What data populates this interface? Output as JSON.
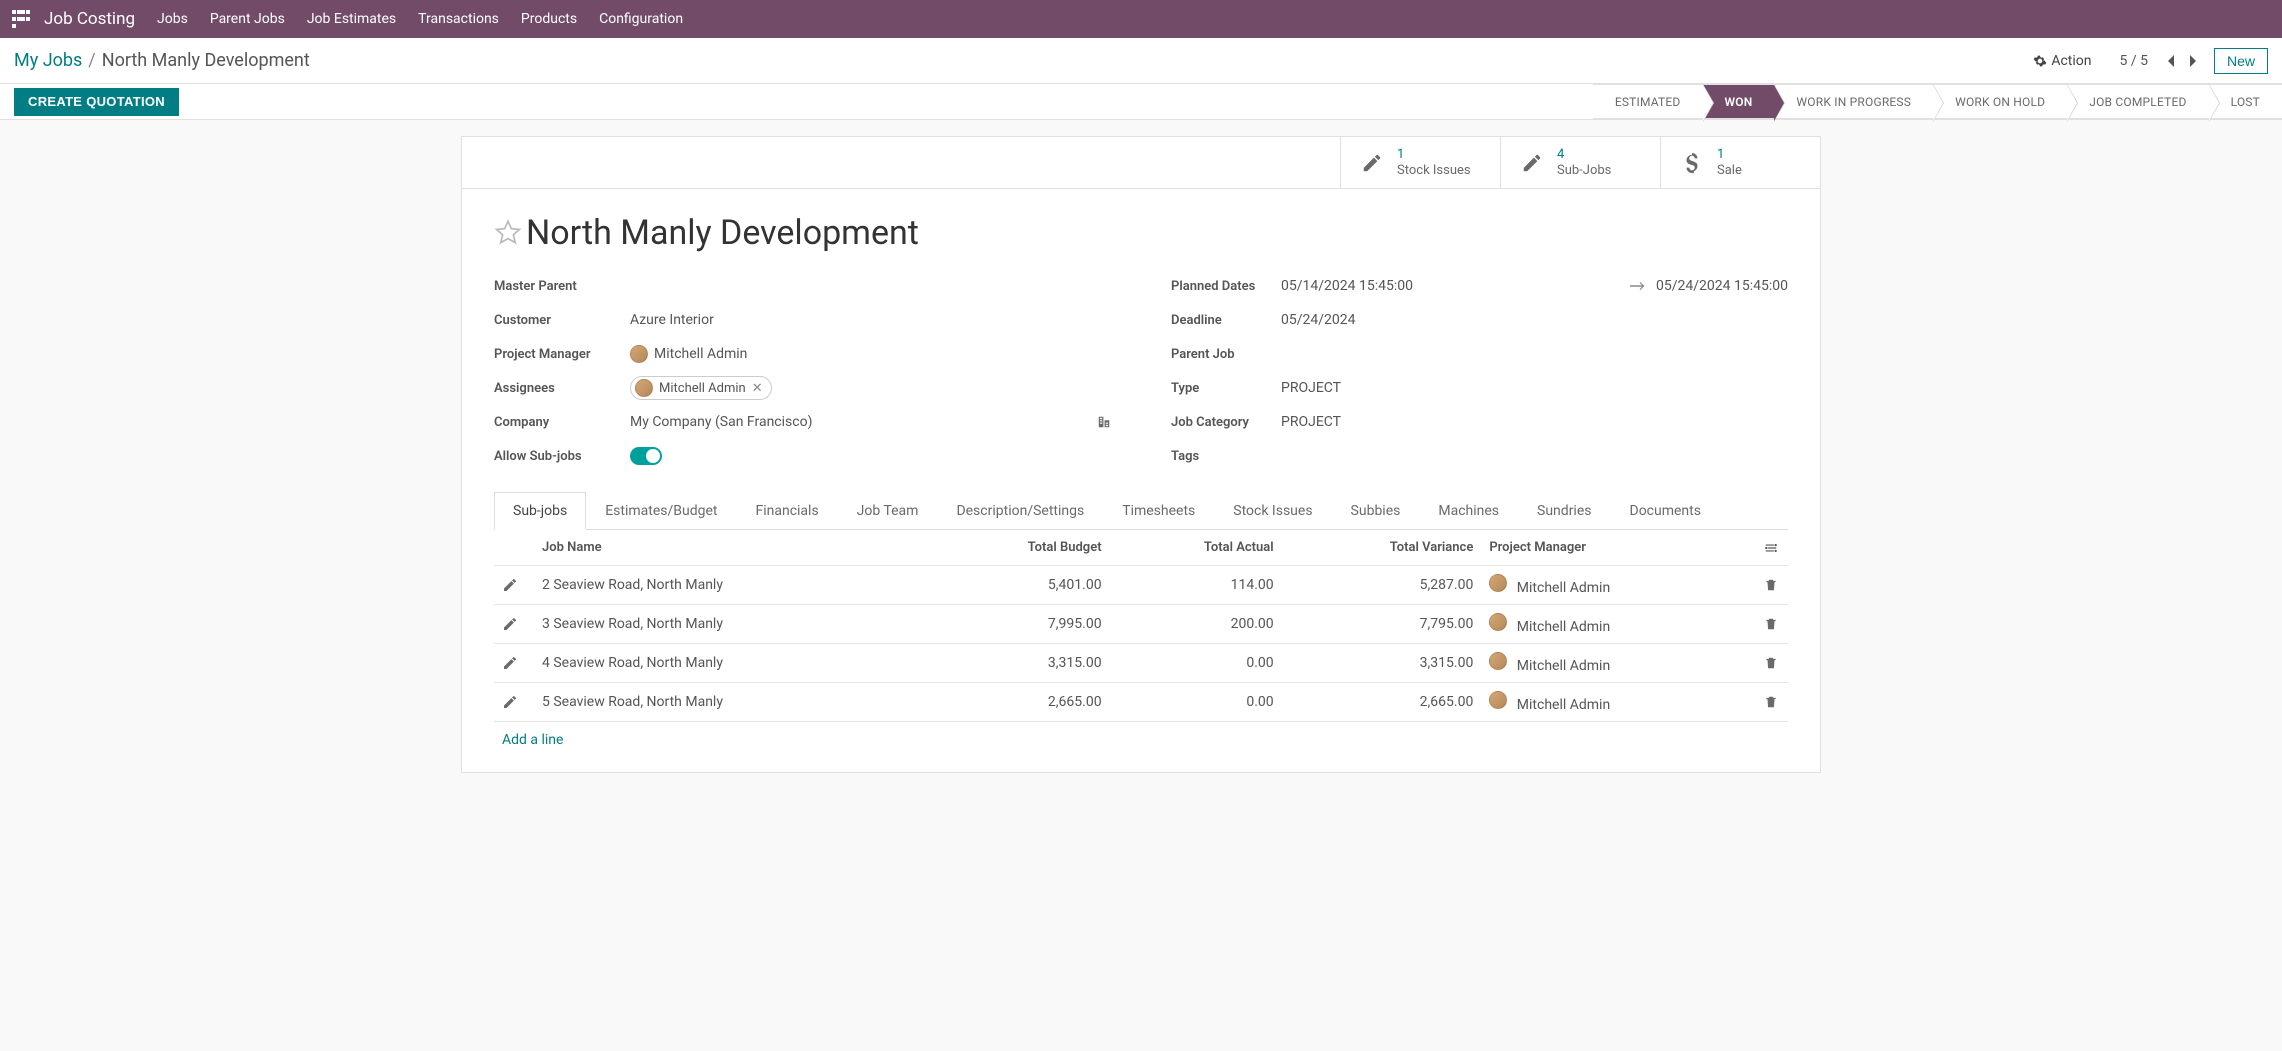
{
  "topnav": {
    "brand": "Job Costing",
    "items": [
      "Jobs",
      "Parent Jobs",
      "Job Estimates",
      "Transactions",
      "Products",
      "Configuration"
    ]
  },
  "breadcrumb": {
    "root": "My Jobs",
    "current": "North Manly Development"
  },
  "controlbar": {
    "action_label": "Action",
    "pager": "5 / 5",
    "new_label": "New"
  },
  "statusbar": {
    "create_quotation": "CREATE QUOTATION",
    "stages": [
      "ESTIMATED",
      "WON",
      "WORK IN PROGRESS",
      "WORK ON HOLD",
      "JOB COMPLETED",
      "LOST"
    ],
    "active_index": 1
  },
  "stats": [
    {
      "count": "1",
      "label": "Stock Issues",
      "icon": "edit"
    },
    {
      "count": "4",
      "label": "Sub-Jobs",
      "icon": "edit"
    },
    {
      "count": "1",
      "label": "Sale",
      "icon": "dollar"
    }
  ],
  "record": {
    "title": "North Manly Development",
    "left": {
      "master_parent": {
        "label": "Master Parent",
        "value": ""
      },
      "customer": {
        "label": "Customer",
        "value": "Azure Interior"
      },
      "project_manager": {
        "label": "Project Manager",
        "value": "Mitchell Admin"
      },
      "assignees": {
        "label": "Assignees",
        "value": "Mitchell Admin"
      },
      "company": {
        "label": "Company",
        "value": "My Company (San Francisco)"
      },
      "allow_subjobs": {
        "label": "Allow Sub-jobs",
        "value": true
      }
    },
    "right": {
      "planned_dates": {
        "label": "Planned Dates",
        "start": "05/14/2024 15:45:00",
        "end": "05/24/2024 15:45:00"
      },
      "deadline": {
        "label": "Deadline",
        "value": "05/24/2024"
      },
      "parent_job": {
        "label": "Parent Job",
        "value": ""
      },
      "type": {
        "label": "Type",
        "value": "PROJECT"
      },
      "job_category": {
        "label": "Job Category",
        "value": "PROJECT"
      },
      "tags": {
        "label": "Tags",
        "value": ""
      }
    }
  },
  "tabs": [
    "Sub-jobs",
    "Estimates/Budget",
    "Financials",
    "Job Team",
    "Description/Settings",
    "Timesheets",
    "Stock Issues",
    "Subbies",
    "Machines",
    "Sundries",
    "Documents"
  ],
  "table": {
    "headers": {
      "job_name": "Job Name",
      "total_budget": "Total Budget",
      "total_actual": "Total Actual",
      "total_variance": "Total Variance",
      "project_manager": "Project Manager"
    },
    "rows": [
      {
        "name": "2 Seaview Road, North Manly",
        "budget": "5,401.00",
        "actual": "114.00",
        "variance": "5,287.00",
        "pm": "Mitchell Admin"
      },
      {
        "name": "3 Seaview Road, North Manly",
        "budget": "7,995.00",
        "actual": "200.00",
        "variance": "7,795.00",
        "pm": "Mitchell Admin"
      },
      {
        "name": "4 Seaview Road, North Manly",
        "budget": "3,315.00",
        "actual": "0.00",
        "variance": "3,315.00",
        "pm": "Mitchell Admin"
      },
      {
        "name": "5 Seaview Road, North Manly",
        "budget": "2,665.00",
        "actual": "0.00",
        "variance": "2,665.00",
        "pm": "Mitchell Admin"
      }
    ],
    "add_line": "Add a line"
  }
}
